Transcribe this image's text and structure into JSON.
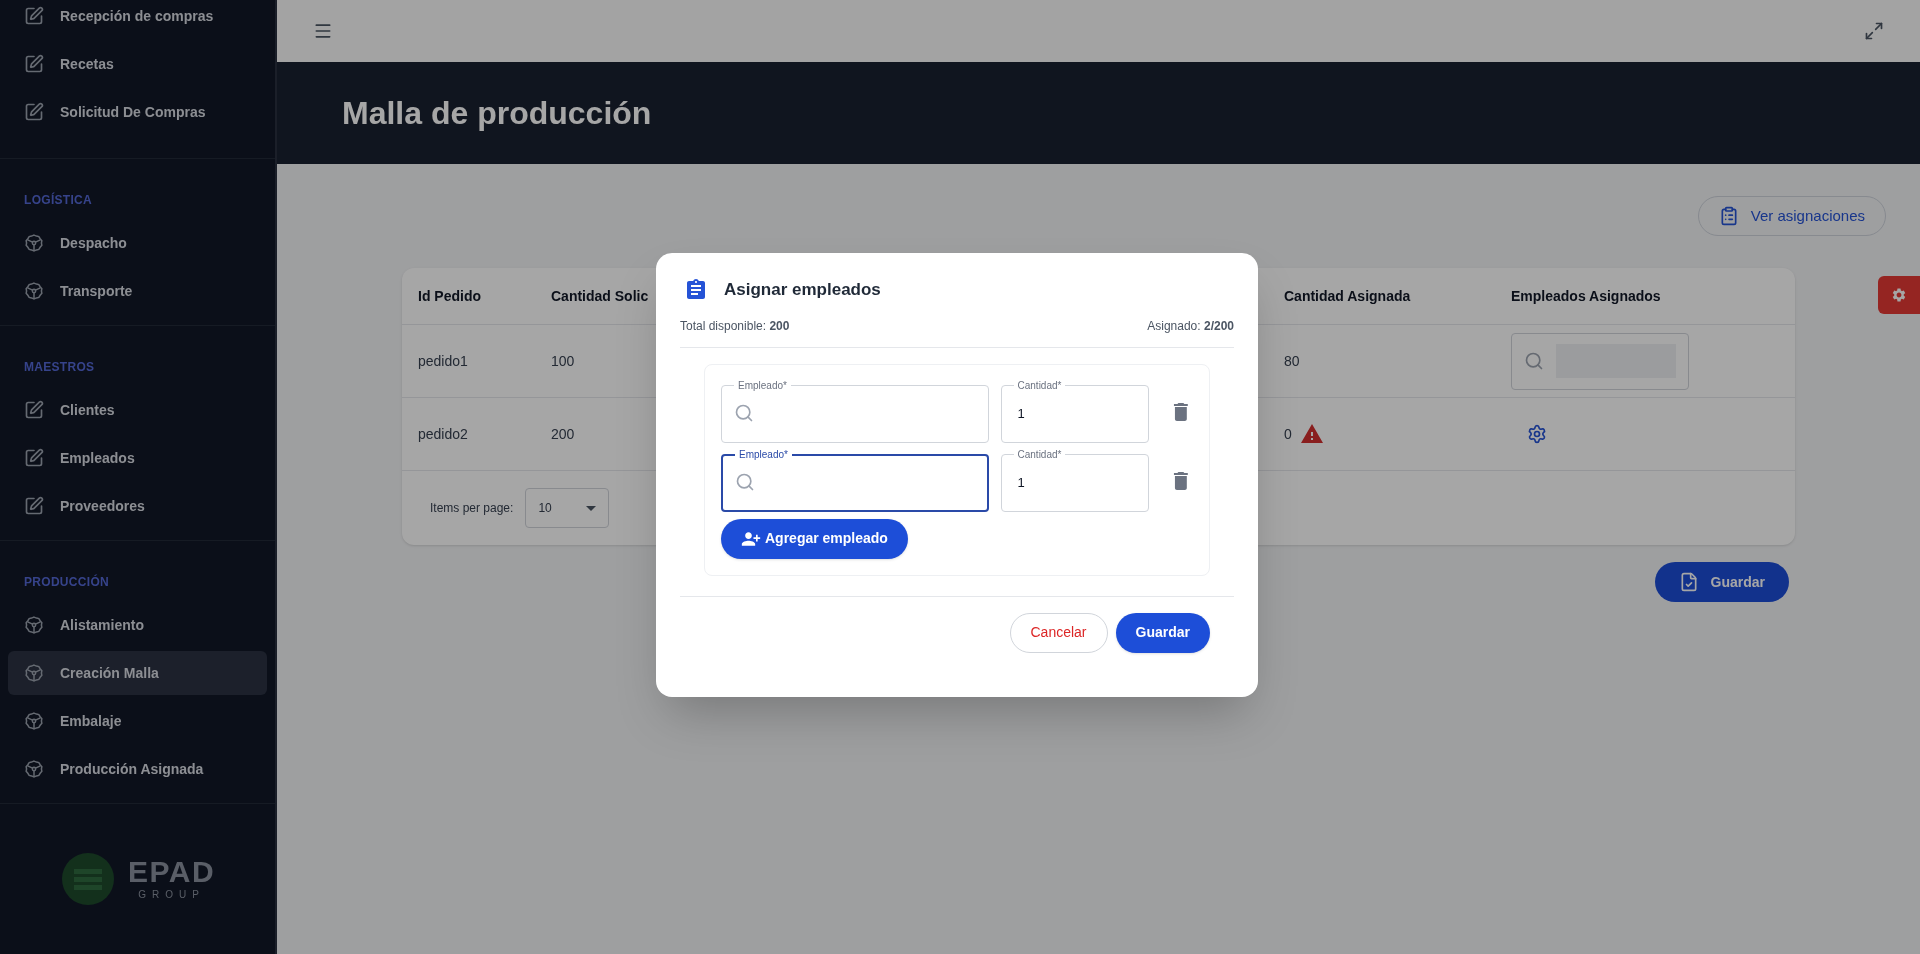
{
  "sidebar": {
    "sections": [
      {
        "items": [
          {
            "label": "Recepción de compras",
            "kind": "edit",
            "selected": false
          },
          {
            "label": "Recetas",
            "kind": "edit",
            "selected": false
          },
          {
            "label": "Solicitud De Compras",
            "kind": "edit",
            "selected": false
          }
        ]
      },
      {
        "heading": "LOGÍSTICA",
        "items": [
          {
            "label": "Despacho",
            "kind": "wheel",
            "selected": false
          },
          {
            "label": "Transporte",
            "kind": "wheel",
            "selected": false
          }
        ]
      },
      {
        "heading": "MAESTROS",
        "items": [
          {
            "label": "Clientes",
            "kind": "edit",
            "selected": false
          },
          {
            "label": "Empleados",
            "kind": "edit",
            "selected": false
          },
          {
            "label": "Proveedores",
            "kind": "edit",
            "selected": false
          }
        ]
      },
      {
        "heading": "PRODUCCIÓN",
        "items": [
          {
            "label": "Alistamiento",
            "kind": "wheel",
            "selected": false
          },
          {
            "label": "Creación Malla",
            "kind": "wheel",
            "selected": true
          },
          {
            "label": "Embalaje",
            "kind": "wheel",
            "selected": false
          },
          {
            "label": "Producción Asignada",
            "kind": "wheel",
            "selected": false
          }
        ]
      }
    ],
    "logo": {
      "name": "EPAD",
      "tagline": "GROUP"
    }
  },
  "page": {
    "title": "Malla de producción",
    "view_button": "Ver asignaciones",
    "save_button": "Guardar"
  },
  "table": {
    "columns": [
      "Id Pedido",
      "Cantidad Solic",
      "Cantidad Asignada",
      "Empleados Asignados"
    ],
    "rows": [
      {
        "id": "pedido1",
        "requested": "100",
        "assigned": "80",
        "warning": false,
        "kind": "search"
      },
      {
        "id": "pedido2",
        "requested": "200",
        "assigned": "0",
        "warning": true,
        "kind": "settings"
      }
    ],
    "items_per_page_label": "Items per page:",
    "items_per_page": "10"
  },
  "dialog": {
    "title": "Asignar empleados",
    "total": "Total disponible: **200**",
    "assigned": "Asignado: **2/200**",
    "entries": [
      {
        "employee_label": "Empleado*",
        "focused": false,
        "quantity_label": "Cantidad*",
        "quantity": "1"
      },
      {
        "employee_label": "Empleado*",
        "focused": true,
        "quantity_label": "Cantidad*",
        "quantity": "1"
      }
    ],
    "add_button": "Agregar empleado",
    "cancel_button": "Cancelar",
    "save_button": "Guardar"
  }
}
